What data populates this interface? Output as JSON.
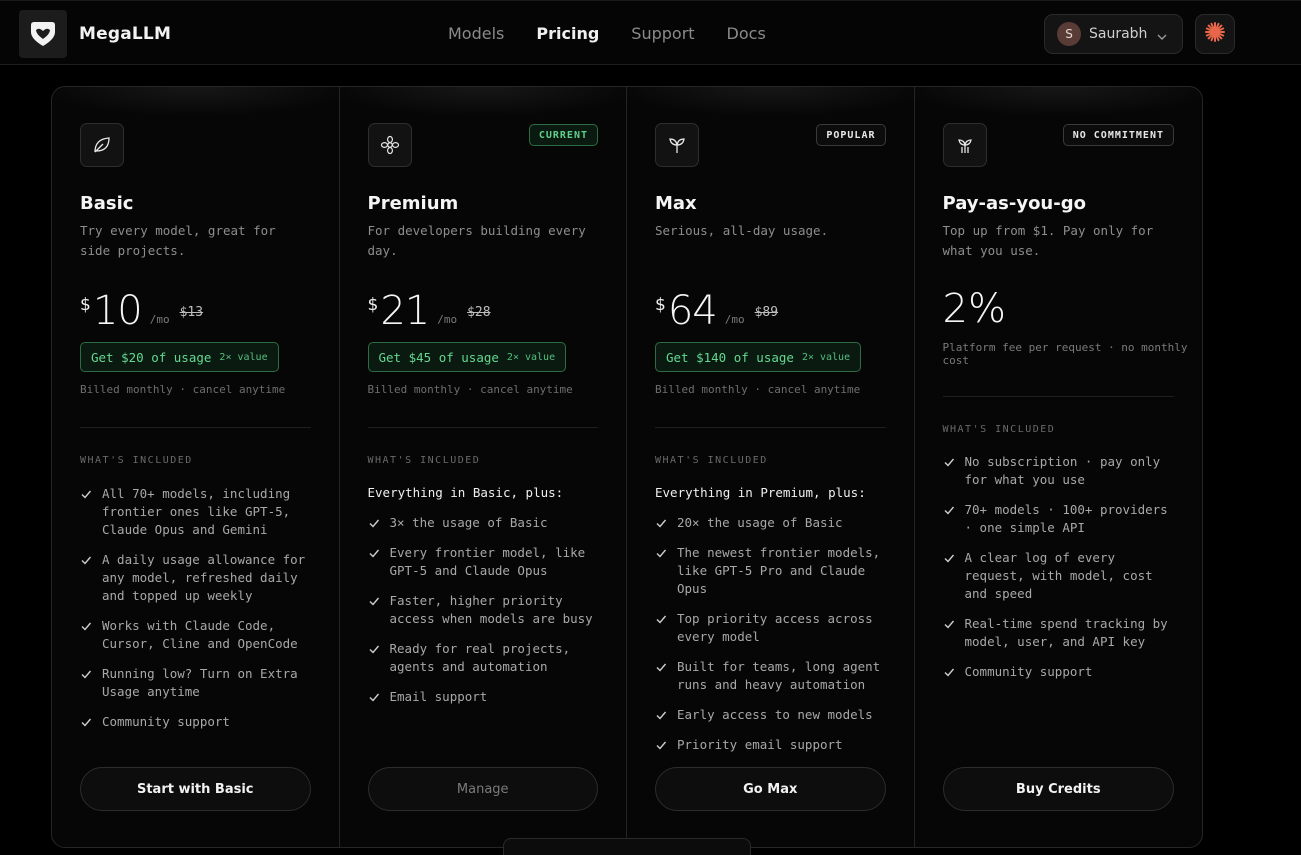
{
  "brand": {
    "name": "MegaLLM",
    "logo_icon": "heart-shield-logo"
  },
  "nav": {
    "links": [
      {
        "label": "Models",
        "active": false
      },
      {
        "label": "Pricing",
        "active": true
      },
      {
        "label": "Support",
        "active": false
      },
      {
        "label": "Docs",
        "active": false
      }
    ]
  },
  "user": {
    "initial": "S",
    "name": "Saurabh",
    "menu_icon": "chevron-down-icon"
  },
  "spark_button": {
    "icon": "sparkle-icon",
    "color": "#e8664a"
  },
  "plans": [
    {
      "icon": "leaf-icon",
      "badge": "",
      "name": "Basic",
      "description": "Try every model, great for side projects.",
      "currency": "$",
      "price": "10",
      "period": "/mo",
      "old_price": "$13",
      "usage": "Get $20 of usage",
      "usage_multiplier": "2× value",
      "billing": "Billed monthly · cancel anytime",
      "included_label": "WHAT'S INCLUDED",
      "plus_line": "",
      "features": [
        "All 70+ models, including frontier ones like GPT-5, Claude Opus and Gemini",
        "A daily usage allowance for any model, refreshed daily and topped up weekly",
        "Works with Claude Code, Cursor, Cline and OpenCode",
        "Running low? Turn on Extra Usage anytime",
        "Community support"
      ],
      "cta": "Start with Basic"
    },
    {
      "icon": "flower-icon",
      "badge": "CURRENT",
      "name": "Premium",
      "description": "For developers building every day.",
      "currency": "$",
      "price": "21",
      "period": "/mo",
      "old_price": "$28",
      "usage": "Get $45 of usage",
      "usage_multiplier": "2× value",
      "billing": "Billed monthly · cancel anytime",
      "included_label": "WHAT'S INCLUDED",
      "plus_line": "Everything in Basic, plus:",
      "features": [
        "3× the usage of Basic",
        "Every frontier model, like GPT-5 and Claude Opus",
        "Faster, higher priority access when models are busy",
        "Ready for real projects, agents and automation",
        "Email support"
      ],
      "cta": "Manage"
    },
    {
      "icon": "sprout-icon",
      "badge": "POPULAR",
      "name": "Max",
      "description": "Serious, all-day usage.",
      "currency": "$",
      "price": "64",
      "period": "/mo",
      "old_price": "$89",
      "usage": "Get $140 of usage",
      "usage_multiplier": "2× value",
      "billing": "Billed monthly · cancel anytime",
      "included_label": "WHAT'S INCLUDED",
      "plus_line": "Everything in Premium, plus:",
      "features": [
        "20× the usage of Basic",
        "The newest frontier models, like GPT-5 Pro and Claude Opus",
        "Top priority access across every model",
        "Built for teams, long agent runs and heavy automation",
        "Early access to new models",
        "Priority email support"
      ],
      "cta": "Go Max"
    },
    {
      "icon": "plant-icon",
      "badge": "NO COMMITMENT",
      "name": "Pay-as-you-go",
      "description": "Top up from $1. Pay only for what you use.",
      "fee": "2%",
      "fee_note": "Platform fee per request · no monthly cost",
      "included_label": "WHAT'S INCLUDED",
      "features": [
        "No subscription · pay only for what you use",
        "70+ models · 100+ providers · one simple API",
        "A clear log of every request, with model, cost and speed",
        "Real-time spend tracking by model, user, and API key",
        "Community support"
      ],
      "cta": "Buy Credits"
    }
  ],
  "colors": {
    "accent_green": "#64d891",
    "background": "#000000",
    "brand_orange": "#e8664a"
  }
}
